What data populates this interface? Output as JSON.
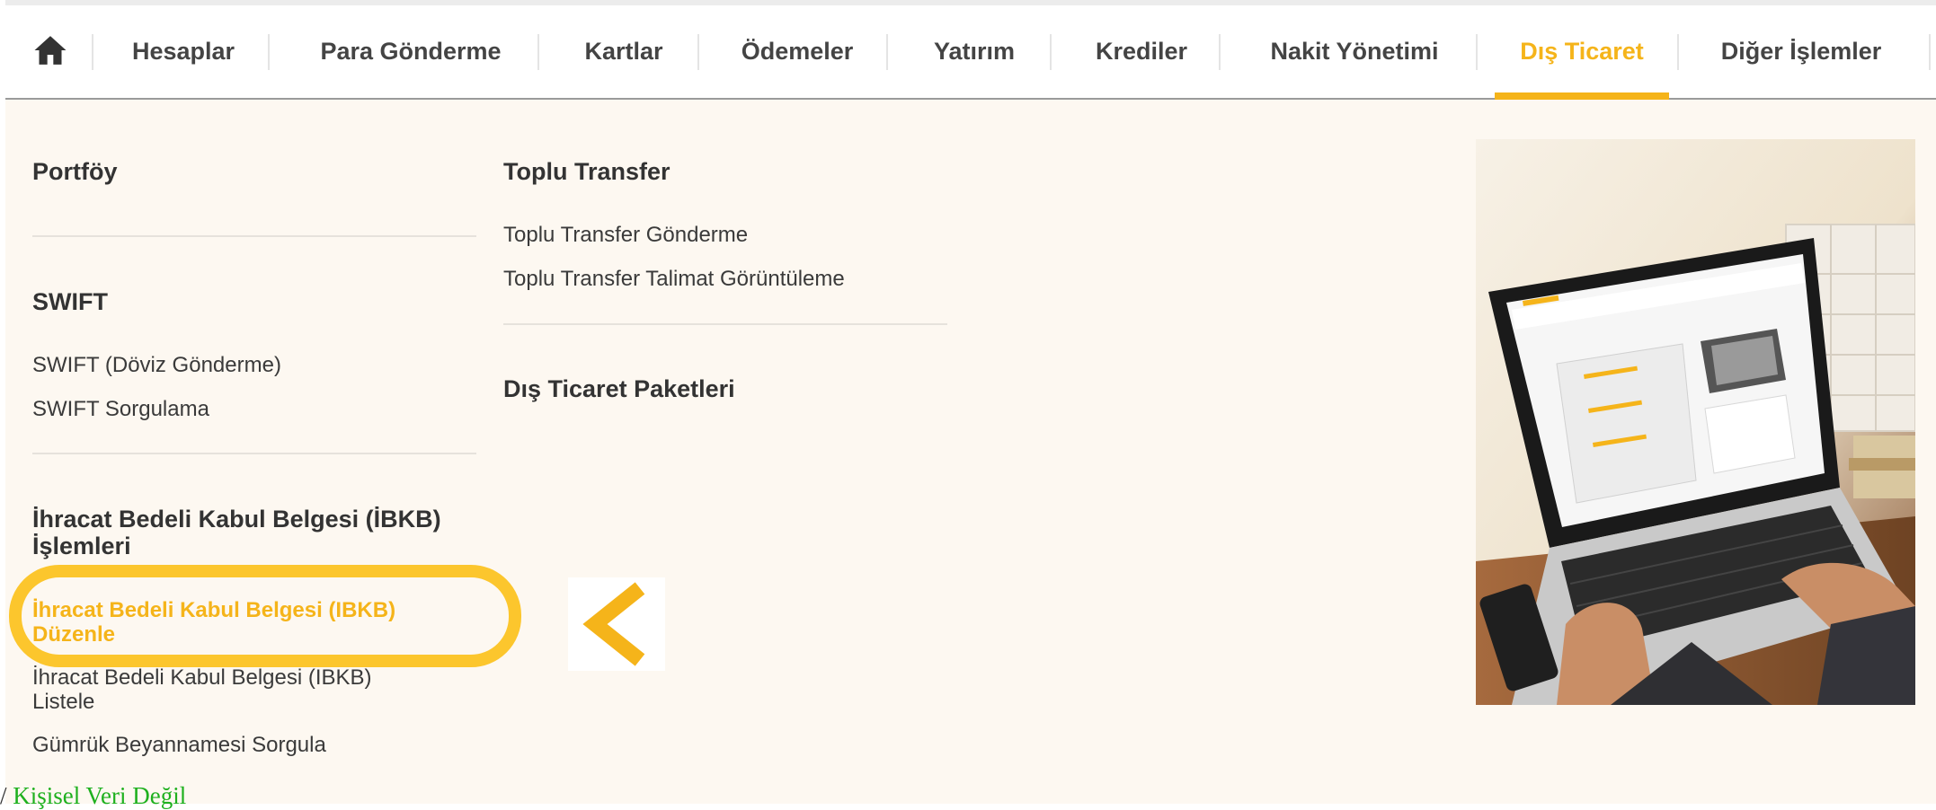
{
  "nav": {
    "items": [
      {
        "label": "Hesaplar"
      },
      {
        "label": "Para Gönderme"
      },
      {
        "label": "Kartlar"
      },
      {
        "label": "Ödemeler"
      },
      {
        "label": "Yatırım"
      },
      {
        "label": "Krediler"
      },
      {
        "label": "Nakit Yönetimi"
      },
      {
        "label": "Dış Ticaret"
      },
      {
        "label": "Diğer İşlemler"
      }
    ],
    "active_item": "Dış Ticaret"
  },
  "menu": {
    "col1": {
      "portfoy": {
        "title": "Portföy"
      },
      "swift": {
        "title": "SWIFT",
        "links": [
          "SWIFT (Döviz Gönderme)",
          "SWIFT Sorgulama"
        ]
      },
      "ibkb": {
        "title_line1": "İhracat Bedeli Kabul Belgesi (İBKB)",
        "title_line2": "İşlemleri",
        "duzenle_line1": "İhracat Bedeli Kabul Belgesi (IBKB)",
        "duzenle_line2": "Düzenle",
        "listele_line1": "İhracat Bedeli Kabul Belgesi (IBKB)",
        "listele_line2": "Listele",
        "gumruk": "Gümrük Beyannamesi Sorgula"
      }
    },
    "col2": {
      "toplu": {
        "title": "Toplu Transfer",
        "links": [
          "Toplu Transfer Gönderme",
          "Toplu Transfer Talimat Görüntüleme"
        ]
      },
      "paketler": {
        "title": "Dış Ticaret Paketleri"
      }
    }
  },
  "footer": {
    "slash": "/",
    "text": "Kişisel Veri Değil"
  },
  "colors": {
    "accent": "#f5b41a",
    "highlight_ring": "#fcc62d",
    "panel_bg": "#fdf8f1",
    "footer_text": "#1eb01e"
  },
  "icons": {
    "home": "home-icon",
    "arrow": "chevron-left-icon",
    "image": "laptop-illustration"
  }
}
